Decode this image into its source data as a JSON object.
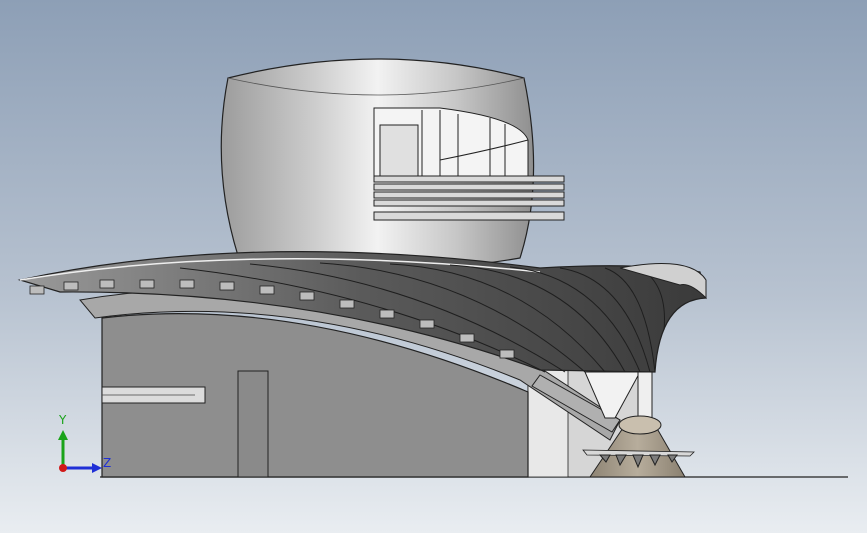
{
  "triad": {
    "y_label": "Y",
    "z_label": "Z",
    "y_color": "#1aa31a",
    "z_color": "#1f2fd6",
    "origin_color": "#d01818"
  },
  "colors": {
    "background_top": "#8fa1b8",
    "background_bottom": "#e6eaef",
    "tower": "#b8b8b8",
    "base_walls": "#8c8c8c",
    "roof_dark": "#3f3f3f"
  }
}
